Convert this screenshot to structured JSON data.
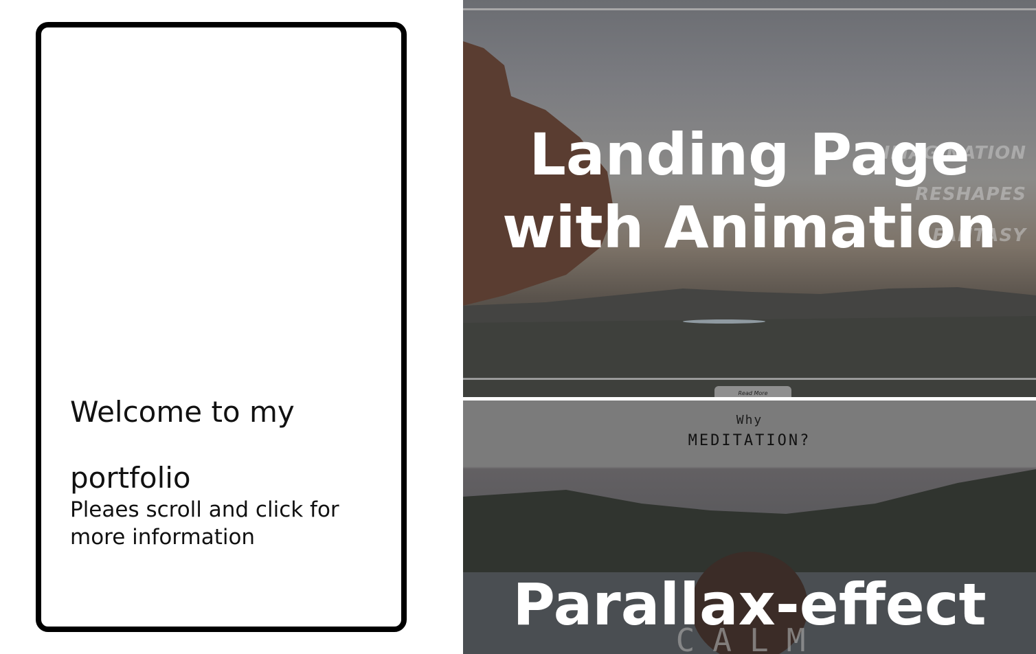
{
  "intro": {
    "welcome": "Welcome to my portfolio",
    "subtitle": "Pleaes scroll and click for more information"
  },
  "projects": [
    {
      "title": "Landing Page with Animation",
      "background_words": [
        "IMAGINATION",
        "RESHAPES",
        "FANTASY"
      ],
      "button_label": "Read More"
    },
    {
      "title": "Parallax-effect",
      "header_small": "Why",
      "header_large": "MEDITATION?",
      "bottom_word": "CALM"
    }
  ],
  "colors": {
    "card_border": "#000000",
    "hero_text": "#ffffff"
  }
}
